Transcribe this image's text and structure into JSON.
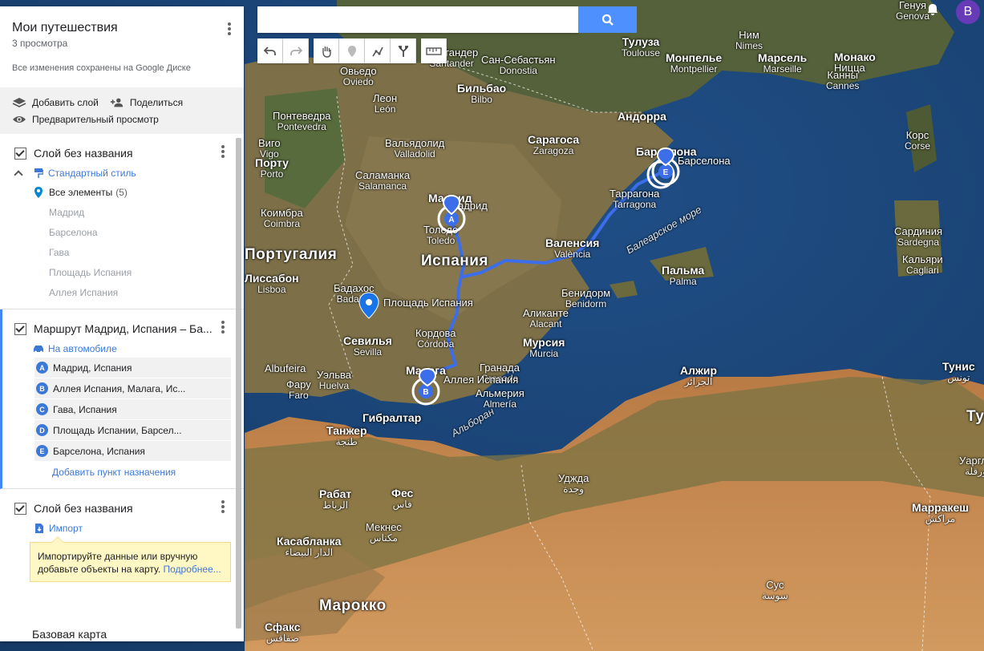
{
  "map": {
    "labels": [
      {
        "ru": "Генуя",
        "loc": "Genova",
        "cls": ""
      },
      {
        "ru": "Тулуза",
        "loc": "Toulouse",
        "cls": "big"
      },
      {
        "ru": "Ним",
        "loc": "Nimes",
        "cls": ""
      },
      {
        "ru": "Монпелье",
        "loc": "Montpellier",
        "cls": "big"
      },
      {
        "ru": "Марсель",
        "loc": "Marseille",
        "cls": "big"
      },
      {
        "ru": "Монако",
        "loc": "",
        "cls": "big"
      },
      {
        "ru": "Ницца",
        "loc": "",
        "cls": ""
      },
      {
        "ru": "Канны",
        "loc": "Cannes",
        "cls": ""
      },
      {
        "ru": "Андорра",
        "loc": "",
        "cls": "big"
      },
      {
        "ru": "Сантандер",
        "loc": "Santander",
        "cls": ""
      },
      {
        "ru": "Сан-Себастьян",
        "loc": "Donostia",
        "cls": ""
      },
      {
        "ru": "Бильбао",
        "loc": "Bilbo",
        "cls": "big"
      },
      {
        "ru": "Овьедо",
        "loc": "Oviedo",
        "cls": ""
      },
      {
        "ru": "Леон",
        "loc": "León",
        "cls": ""
      },
      {
        "ru": "Понтеведра",
        "loc": "Pontevedra",
        "cls": ""
      },
      {
        "ru": "Виго",
        "loc": "Vigo",
        "cls": ""
      },
      {
        "ru": "Вальядолид",
        "loc": "Valladolid",
        "cls": ""
      },
      {
        "ru": "Сарагоса",
        "loc": "Zaragoza",
        "cls": "big"
      },
      {
        "ru": "Корс",
        "loc": "Corse",
        "cls": ""
      },
      {
        "ru": "Барселона",
        "loc": "",
        "cls": "big"
      },
      {
        "ru": "Порту",
        "loc": "Porto",
        "cls": "big"
      },
      {
        "ru": "Саламанка",
        "loc": "Salamanca",
        "cls": ""
      },
      {
        "ru": "Мадрид",
        "loc": "",
        "cls": "big"
      },
      {
        "ru": "Таррагона",
        "loc": "Tarragona",
        "cls": ""
      },
      {
        "ru": "Коимбра",
        "loc": "Coimbra",
        "cls": ""
      },
      {
        "ru": "Толедо",
        "loc": "Toledo",
        "cls": ""
      },
      {
        "ru": "Португалия",
        "loc": "",
        "cls": "country"
      },
      {
        "ru": "Испания",
        "loc": "",
        "cls": "country"
      },
      {
        "ru": "Валенсия",
        "loc": "València",
        "cls": "big"
      },
      {
        "ru": "Сардиния",
        "loc": "Sardegna",
        "cls": ""
      },
      {
        "ru": "Пальма",
        "loc": "Palma",
        "cls": "big"
      },
      {
        "ru": "Кальяри",
        "loc": "Cagliari",
        "cls": ""
      },
      {
        "ru": "Лиссабон",
        "loc": "Lisboa",
        "cls": "big"
      },
      {
        "ru": "Бадахос",
        "loc": "Badajoz",
        "cls": ""
      },
      {
        "ru": "Бенидорм",
        "loc": "Benidorm",
        "cls": ""
      },
      {
        "ru": "Аликанте",
        "loc": "Alacant",
        "cls": ""
      },
      {
        "ru": "Кордова",
        "loc": "Córdoba",
        "cls": ""
      },
      {
        "ru": "Севилья",
        "loc": "Sevilla",
        "cls": "big"
      },
      {
        "ru": "Мурсия",
        "loc": "Murcia",
        "cls": "big"
      },
      {
        "ru": "Гранада",
        "loc": "Granada",
        "cls": ""
      },
      {
        "ru": "Альмерия",
        "loc": "Almería",
        "cls": ""
      },
      {
        "ru": "Алжир",
        "loc": "الجزائر",
        "cls": "big"
      },
      {
        "ru": "Тунис",
        "loc": "تونس",
        "cls": "big"
      },
      {
        "ru": "Уэльва",
        "loc": "Huelva",
        "cls": ""
      },
      {
        "ru": "Фару",
        "loc": "Faro",
        "cls": ""
      },
      {
        "ru": "Albufeira",
        "loc": "",
        "cls": ""
      },
      {
        "ru": "Малага",
        "loc": "",
        "cls": "big"
      },
      {
        "ru": "Гибралтар",
        "loc": "",
        "cls": "big"
      },
      {
        "ru": "Танжер",
        "loc": "طنجة",
        "cls": "big"
      },
      {
        "ru": "Уджда",
        "loc": "وجدة",
        "cls": ""
      },
      {
        "ru": "Рабат",
        "loc": "الرباط",
        "cls": "big"
      },
      {
        "ru": "Фес",
        "loc": "فاس",
        "cls": "big"
      },
      {
        "ru": "Мекнес",
        "loc": "مكناس",
        "cls": ""
      },
      {
        "ru": "Касабланка",
        "loc": "الدار البيضاء",
        "cls": "big"
      },
      {
        "ru": "Марокко",
        "loc": "",
        "cls": "country"
      },
      {
        "ru": "Марракеш",
        "loc": "مراكش",
        "cls": "big"
      },
      {
        "ru": "Уаргла",
        "loc": "ورقلة",
        "cls": ""
      },
      {
        "ru": "Тунис",
        "loc": "",
        "cls": "country"
      },
      {
        "ru": "Сфакс",
        "loc": "صفاقس",
        "cls": "big"
      },
      {
        "ru": "Сус",
        "loc": "سوسة",
        "cls": ""
      },
      {
        "ru": "Балеарское море",
        "loc": "",
        "cls": "sea"
      },
      {
        "ru": "Альборан",
        "loc": "",
        "cls": "sea"
      },
      {
        "ru": "Мадрид",
        "loc": "",
        "cls": "poi"
      },
      {
        "ru": "Барселона",
        "loc": "",
        "cls": "poi"
      },
      {
        "ru": "Площадь Испания",
        "loc": "",
        "cls": "poi"
      },
      {
        "ru": "Аллея Испания",
        "loc": "",
        "cls": "poi"
      }
    ],
    "route_markers": [
      "A",
      "B",
      "E"
    ]
  },
  "panel": {
    "title": "Мои путешествия",
    "views": "3 просмотра",
    "saved": "Все изменения сохранены на Google Диске",
    "actions": {
      "add_layer": "Добавить слой",
      "share": "Поделиться",
      "preview": "Предварительный просмотр"
    },
    "layer1": {
      "name": "Слой без названия",
      "style": "Стандартный стиль",
      "all_items": "Все элементы",
      "count": "(5)",
      "items": [
        "Мадрид",
        "Барселона",
        "Гава",
        "Площадь Испания",
        "Аллея Испания"
      ]
    },
    "route": {
      "name": "Маршрут Мадрид, Испания – Ба...",
      "mode": "На автомобиле",
      "waypoints": [
        {
          "letter": "A",
          "label": "Мадрид, Испания"
        },
        {
          "letter": "B",
          "label": "Аллея Испания, Малага, Ис..."
        },
        {
          "letter": "C",
          "label": "Гава, Испания"
        },
        {
          "letter": "D",
          "label": "Площадь Испании, Барсел..."
        },
        {
          "letter": "E",
          "label": "Барселона, Испания"
        }
      ],
      "add_destination": "Добавить пункт назначения"
    },
    "layer3": {
      "name": "Слой без названия",
      "import": "Импорт",
      "tip": "Импортируйте данные или вручную добавьте объекты на карту.",
      "tip_link": "Подробнее..."
    },
    "basemap": "Базовая карта"
  },
  "search": {
    "placeholder": "",
    "value": ""
  },
  "user": {
    "initial": "B",
    "color": "#673ab7"
  },
  "colors": {
    "route": "#3b6ee8",
    "accent": "#4d90fe"
  }
}
